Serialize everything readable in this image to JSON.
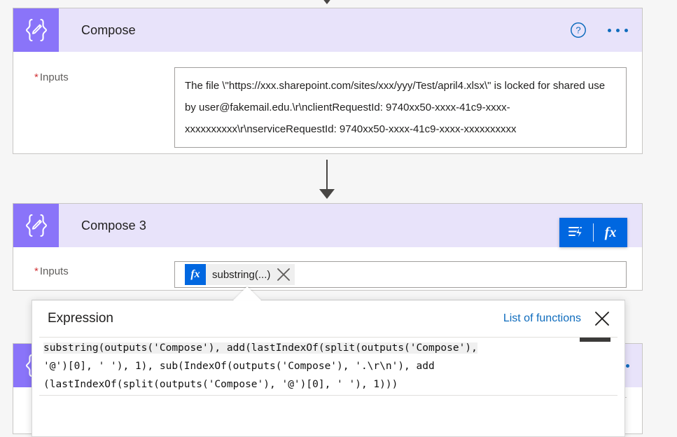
{
  "app": {
    "background_color": "#f6f6f6",
    "accent_blue": "#0067e0",
    "link_blue": "#0f6cbd",
    "card_header_purple": "#e8e3fa",
    "icon_tile_purple": "#8a74f9",
    "required_red": "#d13438"
  },
  "cards": [
    {
      "title": "Compose",
      "icon": "compose-braces-pencil-icon",
      "help_icon": "help-question-circle-icon",
      "menu_icon": "ellipsis-horizontal-icon",
      "field_label": "Inputs",
      "required_marker": "*",
      "value": "The file \\\"https://xxx.sharepoint.com/sites/xxx/yyy/Test/april4.xlsx\\\" is locked for shared use by user@fakemail.edu.\\r\\nclientRequestId: 9740xx50-xxxx-41c9-xxxx-xxxxxxxxxx\\r\\nserviceRequestId: 9740xx50-xxxx-41c9-xxxx-xxxxxxxxxx"
    },
    {
      "title": "Compose 3",
      "icon": "compose-braces-pencil-icon",
      "help_icon": "help-question-circle-icon",
      "field_label": "Inputs",
      "required_marker": "*",
      "token_label": "substring(...)",
      "token_fx_label": "fx",
      "token_remove_icon": "close-x-icon",
      "toolbar": {
        "dynamic_content_icon": "dynamic-content-lightning-icon",
        "expression_icon": "fx",
        "expression_icon_name": "expression-fx-icon"
      }
    }
  ],
  "expression_panel": {
    "title": "Expression",
    "list_of_functions_label": "List of functions",
    "close_icon": "close-x-icon",
    "expression_lines": [
      "substring(outputs('Compose'), add(lastIndexOf(split(outputs('Compose'),",
      "'@')[0], ' '), 1), sub(IndexOf(outputs('Compose'), '.\\r\\n'), add",
      "(lastIndexOf(split(outputs('Compose'), '@')[0], ' '), 1)))"
    ],
    "scrollbar": "horizontal-scrollbar-thumb"
  },
  "connectors": [
    {
      "name": "arrow-top-partial"
    },
    {
      "name": "arrow-compose-to-compose3"
    }
  ]
}
